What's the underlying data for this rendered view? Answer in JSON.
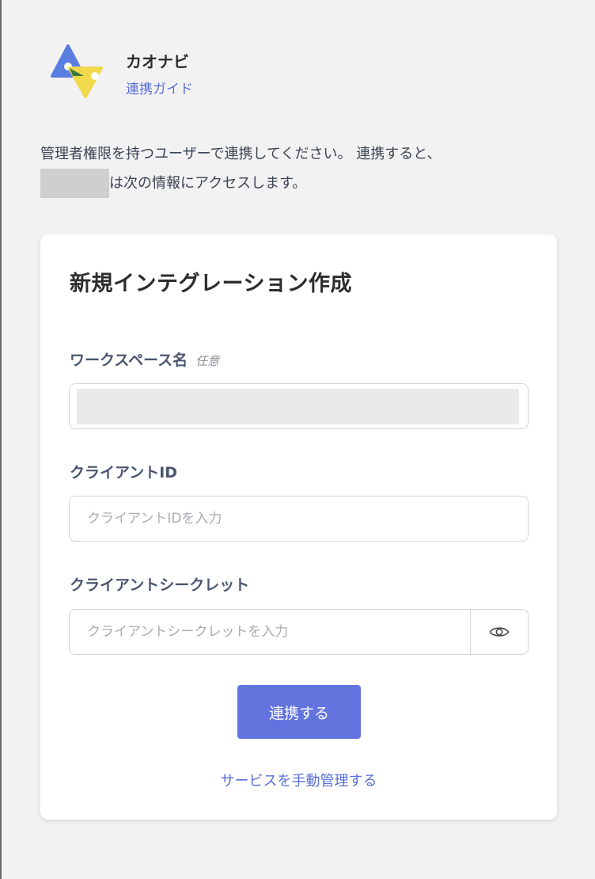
{
  "header": {
    "app_name": "カオナビ",
    "guide_link": "連携ガイド"
  },
  "intro": {
    "line1": "管理者権限を持つユーザーで連携してください。 連携すると、",
    "line2": "は次の情報にアクセスします。"
  },
  "form": {
    "title": "新規インテグレーション作成",
    "workspace": {
      "label": "ワークスペース名",
      "optional": "任意",
      "value": ""
    },
    "client_id": {
      "label": "クライアントID",
      "placeholder": "クライアントIDを入力"
    },
    "client_secret": {
      "label": "クライアントシークレット",
      "placeholder": "クライアントシークレットを入力",
      "toggle_icon": "eye-icon"
    },
    "submit_label": "連携する",
    "manual_link": "サービスを手動管理する"
  },
  "colors": {
    "accent": "#6374df",
    "link": "#5a6fd8",
    "background": "#f2f2f2"
  }
}
